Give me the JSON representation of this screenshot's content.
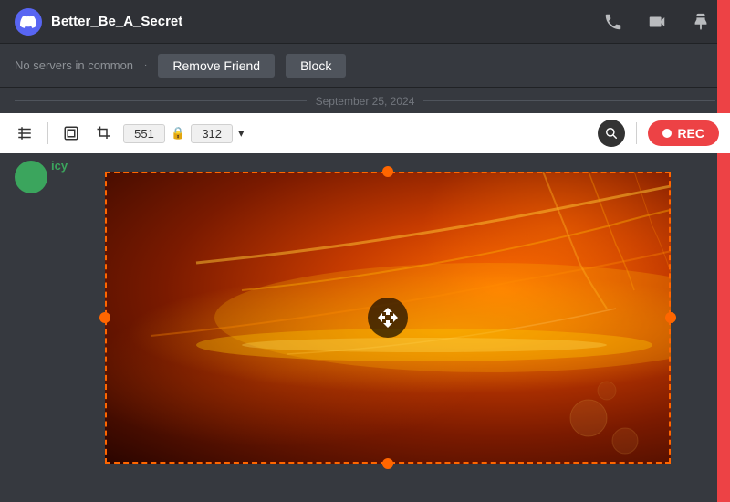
{
  "titleBar": {
    "username": "Better_Be_A_Secret",
    "logoSymbol": "🎮"
  },
  "friendsBar": {
    "noServersText": "No servers in common",
    "separator": "·",
    "removeFriendLabel": "Remove Friend",
    "blockLabel": "Block"
  },
  "dateSeparator": {
    "text": "September 25, 2024"
  },
  "screenshotToolbar": {
    "width": "551",
    "height": "312",
    "chevron": "▾",
    "recLabel": "REC"
  },
  "mainContent": {
    "usernameLabel": "icy"
  }
}
